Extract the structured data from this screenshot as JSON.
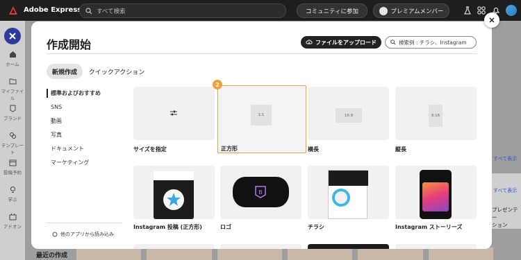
{
  "app": {
    "title": "Adobe Express",
    "search_placeholder": "すべて検索",
    "community_label": "コミュニティに参加",
    "premium_label": "プレミアムメンバー"
  },
  "rail": {
    "items": [
      {
        "label": "ホーム",
        "icon": "home-icon"
      },
      {
        "label": "マイファイル",
        "icon": "folder-icon"
      },
      {
        "label": "ブランド",
        "icon": "brand-icon"
      },
      {
        "label": "テンプレート",
        "icon": "template-icon"
      },
      {
        "label": "投稿予約",
        "icon": "calendar-icon"
      },
      {
        "label": "学ぶ",
        "icon": "bulb-icon"
      },
      {
        "label": "アドオン",
        "icon": "addon-icon"
      }
    ]
  },
  "background": {
    "see_all_1": "すべて表示",
    "see_all_2": "すべて表示",
    "presentation": "プレゼンテー\nション",
    "recent": "最近の作成"
  },
  "modal": {
    "title": "作成開始",
    "upload_label": "ファイルをアップロード",
    "search_placeholder": "検索例 : チラシ、Instagram",
    "tabs": [
      {
        "label": "新規作成",
        "active": true
      },
      {
        "label": "クイックアクション",
        "active": false
      }
    ],
    "categories": [
      {
        "label": "標準およびおすすめ",
        "active": true
      },
      {
        "label": "SNS"
      },
      {
        "label": "動画"
      },
      {
        "label": "写真"
      },
      {
        "label": "ドキュメント"
      },
      {
        "label": "マーケティング"
      }
    ],
    "import_label": "他のアプリから読み込み",
    "badge": "2",
    "cards": [
      {
        "label": "サイズを指定",
        "ratio": ""
      },
      {
        "label": "正方形",
        "ratio": "1:1"
      },
      {
        "label": "横長",
        "ratio": "16:9"
      },
      {
        "label": "縦長",
        "ratio": "9:16"
      },
      {
        "label": "Instagram 投稿 (正方形)"
      },
      {
        "label": "ロゴ"
      },
      {
        "label": "チラシ"
      },
      {
        "label": "Instagram ストーリーズ"
      }
    ]
  },
  "colors": {
    "accent": "#f2a03e",
    "brand_blue": "#2d3a9c"
  }
}
